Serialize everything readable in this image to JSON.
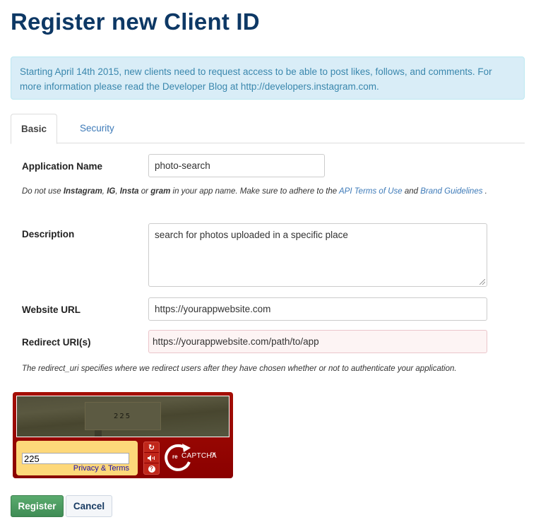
{
  "page": {
    "title": "Register new Client ID"
  },
  "alert": {
    "text": "Starting April 14th 2015, new clients need to request access to be able to post likes, follows, and comments. For more information please read the Developer Blog at http://developers.instagram.com."
  },
  "tabs": [
    {
      "label": "Basic",
      "active": true
    },
    {
      "label": "Security",
      "active": false
    }
  ],
  "form": {
    "app_name": {
      "label": "Application Name",
      "value": "photo-search"
    },
    "app_name_help": {
      "prefix": "Do not use ",
      "word1": "Instagram",
      "sep1": ", ",
      "word2": "IG",
      "sep2": ", ",
      "word3": "Insta",
      "sep3": " or ",
      "word4": "gram",
      "middle": " in your app name. Make sure to adhere to the ",
      "link1": "API Terms of Use",
      "and": " and ",
      "link2": "Brand Guidelines",
      "suffix": " ."
    },
    "description": {
      "label": "Description",
      "value": "search for photos uploaded in a specific place"
    },
    "website_url": {
      "label": "Website URL",
      "value": "https://yourappwebsite.com"
    },
    "redirect_uri": {
      "label": "Redirect URI(s)",
      "value": "https://yourappwebsite.com/path/to/app",
      "state": "error"
    },
    "redirect_help": "The redirect_uri specifies where we redirect users after they have chosen whether or not to authenticate your application."
  },
  "captcha": {
    "image_text": "225",
    "answer_value": "225",
    "privacy_link": "Privacy & Terms",
    "reload_icon": "↻",
    "audio_icon": "◀))",
    "help_icon": "?",
    "logo_re": "re",
    "logo_text": "CAPTCHA",
    "logo_tm": "TM"
  },
  "actions": {
    "register_label": "Register",
    "cancel_label": "Cancel"
  },
  "colors": {
    "title": "#0d3865",
    "link": "#3d7ab8",
    "alert_bg": "#d9edf7",
    "register_bg": "#4a9c60",
    "captcha_red": "#9a0a02"
  }
}
